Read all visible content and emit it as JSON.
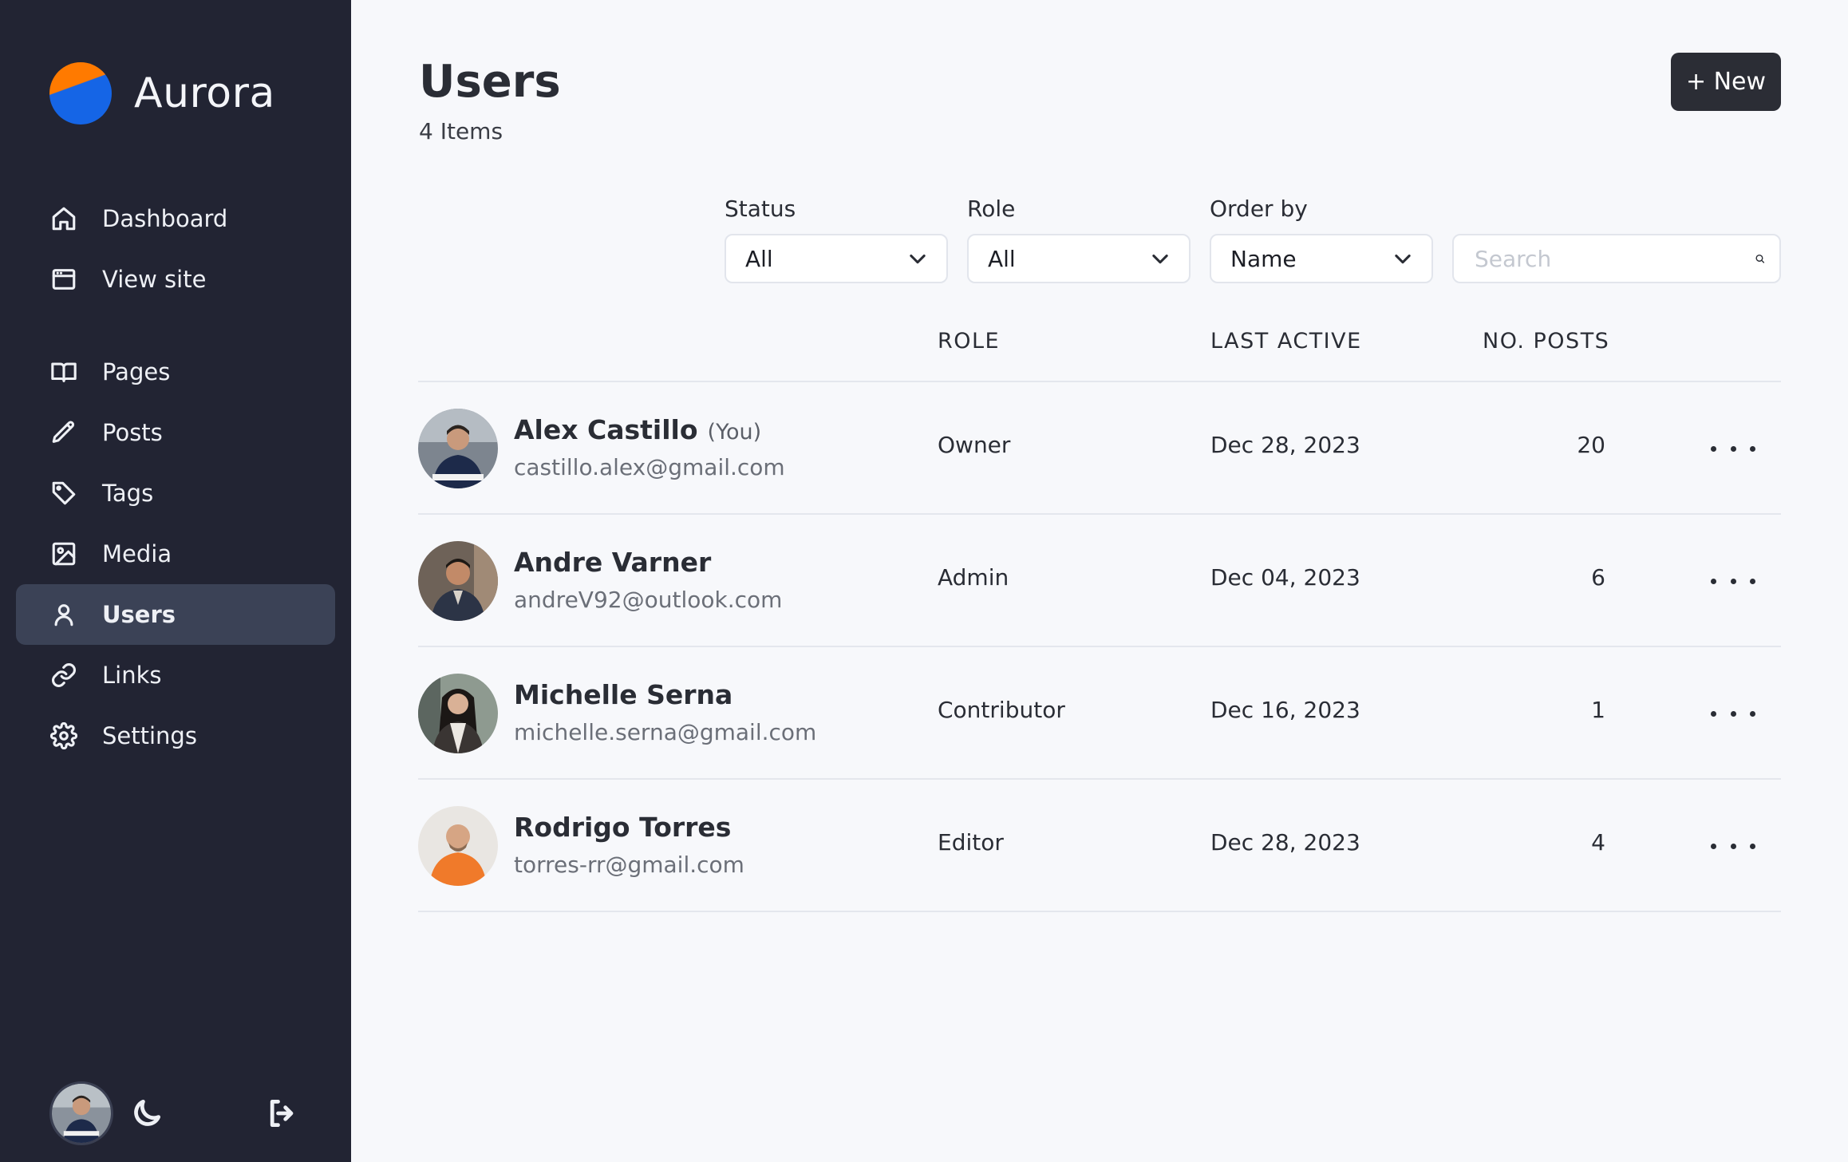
{
  "app": {
    "name": "Aurora"
  },
  "sidebar": {
    "items": [
      {
        "label": "Dashboard",
        "icon": "home-icon"
      },
      {
        "label": "View site",
        "icon": "browser-window-icon"
      },
      {
        "label": "Pages",
        "icon": "book-open-icon"
      },
      {
        "label": "Posts",
        "icon": "pencil-icon"
      },
      {
        "label": "Tags",
        "icon": "tag-icon"
      },
      {
        "label": "Media",
        "icon": "image-icon"
      },
      {
        "label": "Users",
        "icon": "user-icon",
        "active": true
      },
      {
        "label": "Links",
        "icon": "link-icon"
      },
      {
        "label": "Settings",
        "icon": "gear-icon"
      }
    ],
    "footer": {
      "theme_icon": "moon-icon",
      "logout_icon": "logout-icon"
    }
  },
  "header": {
    "title": "Users",
    "count": "4 Items",
    "new_button": "+ New"
  },
  "filters": {
    "status": {
      "label": "Status",
      "value": "All"
    },
    "role": {
      "label": "Role",
      "value": "All"
    },
    "order_by": {
      "label": "Order by",
      "value": "Name"
    },
    "search": {
      "placeholder": "Search"
    }
  },
  "table": {
    "columns": {
      "role": "ROLE",
      "last_active": "LAST ACTIVE",
      "posts": "NO. POSTS"
    },
    "rows": [
      {
        "name": "Alex Castillo",
        "tag": "(You)",
        "email": "castillo.alex@gmail.com",
        "role": "Owner",
        "last_active": "Dec 28, 2023",
        "posts": "20"
      },
      {
        "name": "Andre Varner",
        "tag": "",
        "email": "andreV92@outlook.com",
        "role": "Admin",
        "last_active": "Dec 04, 2023",
        "posts": "6"
      },
      {
        "name": "Michelle Serna",
        "tag": "",
        "email": "michelle.serna@gmail.com",
        "role": "Contributor",
        "last_active": "Dec 16, 2023",
        "posts": "1"
      },
      {
        "name": "Rodrigo Torres",
        "tag": "",
        "email": "torres-rr@gmail.com",
        "role": "Editor",
        "last_active": "Dec 28, 2023",
        "posts": "4"
      }
    ]
  },
  "colors": {
    "sidebar_bg": "#222433",
    "active_item_bg": "#3b4256",
    "page_bg": "#f7f8fb",
    "button_bg": "#2b2d35",
    "logo_orange": "#ff7a00",
    "logo_blue": "#1565e6"
  }
}
